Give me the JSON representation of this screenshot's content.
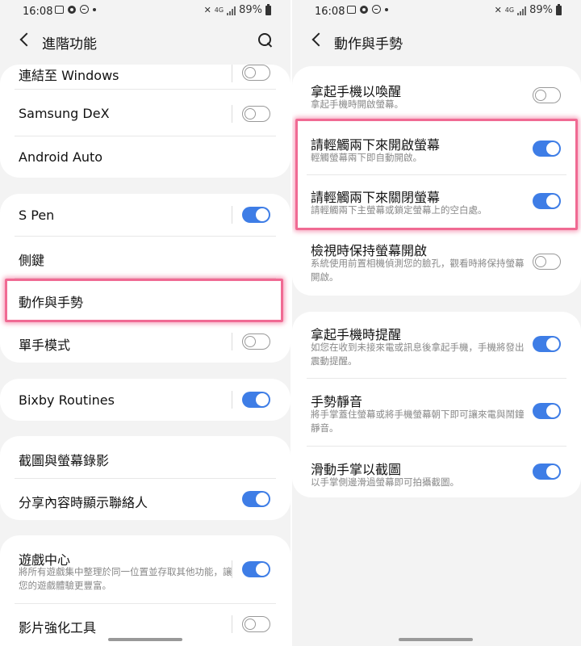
{
  "left": {
    "status": {
      "time": "16:08",
      "battery": "89%",
      "net": "4G"
    },
    "header": {
      "title": "進階功能"
    },
    "card1": [
      {
        "label": "連結至 Windows",
        "toggle": "off"
      },
      {
        "label": "Samsung DeX",
        "toggle": "off"
      },
      {
        "label": "Android Auto"
      }
    ],
    "card2": [
      {
        "label": "S Pen",
        "toggle": "on"
      },
      {
        "label": "側鍵"
      },
      {
        "label": "動作與手勢"
      },
      {
        "label": "單手模式",
        "toggle": "off"
      }
    ],
    "card3": [
      {
        "label": "Bixby Routines",
        "toggle": "on"
      }
    ],
    "card4": [
      {
        "label": "截圖與螢幕錄影"
      },
      {
        "label": "分享內容時顯示聯絡人",
        "toggle": "on"
      }
    ],
    "card5": [
      {
        "label": "遊戲中心",
        "desc": "將所有遊戲集中整理於同一位置並存取其他功能，讓您的遊戲體驗更豐富。",
        "toggle": "on"
      },
      {
        "label": "影片強化工具",
        "toggle": "off"
      }
    ]
  },
  "right": {
    "status": {
      "time": "16:08",
      "battery": "89%",
      "net": "4G"
    },
    "header": {
      "title": "動作與手勢"
    },
    "card1": [
      {
        "label": "拿起手機以喚醒",
        "desc": "拿起手機時開啟螢幕。",
        "toggle": "off"
      },
      {
        "label": "請輕觸兩下來開啟螢幕",
        "desc": "輕觸螢幕兩下即自動開啟。",
        "toggle": "on"
      },
      {
        "label": "請輕觸兩下來關閉螢幕",
        "desc": "請輕觸兩下主螢幕或鎖定螢幕上的空白處。",
        "toggle": "on"
      },
      {
        "label": "檢視時保持螢幕開啟",
        "desc": "系統使用前置相機偵測您的臉孔，觀看時將保持螢幕開啟。",
        "toggle": "off"
      }
    ],
    "card2": [
      {
        "label": "拿起手機時提醒",
        "desc": "如您在收到未接來電或訊息後拿起手機，手機將發出震動提醒。",
        "toggle": "on"
      },
      {
        "label": "手勢靜音",
        "desc": "將手掌蓋住螢幕或將手機螢幕朝下即可讓來電與鬧鐘靜音。",
        "toggle": "on"
      },
      {
        "label": "滑動手掌以截圖",
        "desc": "以手掌側邊滑過螢幕即可拍攝截圖。",
        "toggle": "on"
      }
    ]
  },
  "colors": {
    "accent": "#3e7de6",
    "highlight": "#f06a93",
    "background": "#f3f3f3",
    "card": "#ffffff"
  }
}
